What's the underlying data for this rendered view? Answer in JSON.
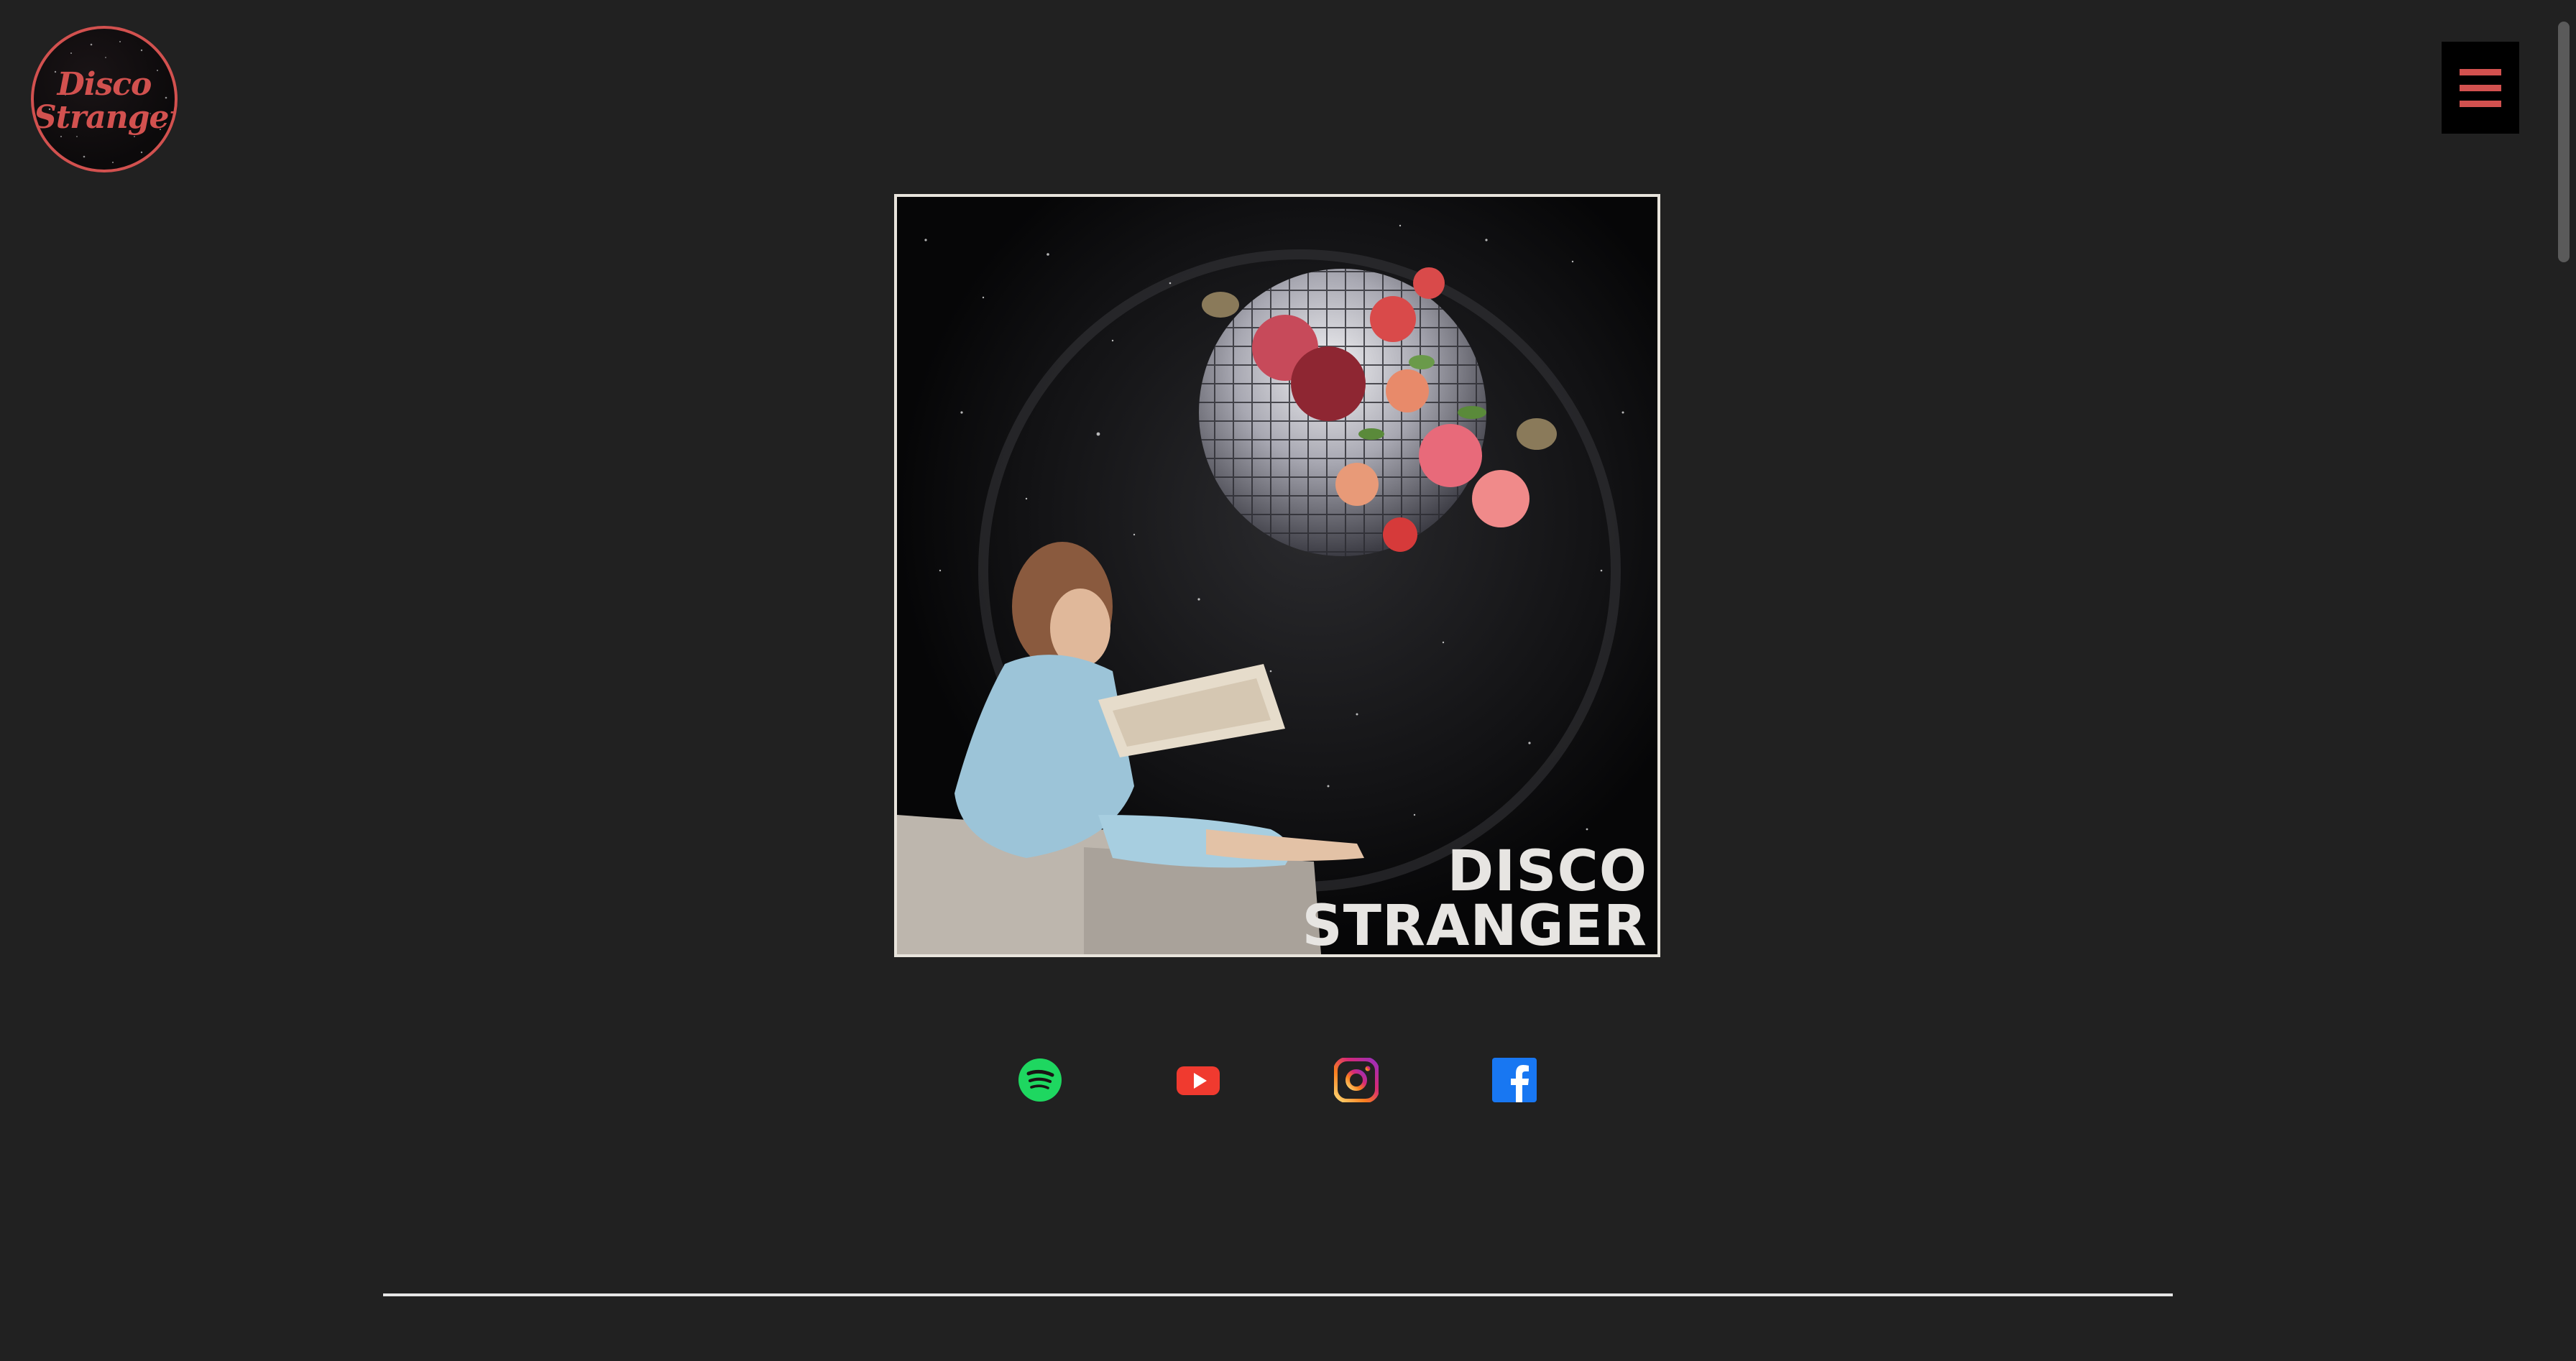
{
  "header": {
    "logo": {
      "line1": "Disco",
      "line2": "Stranger",
      "icon": "disco-stranger-logo"
    },
    "menu_button": {
      "icon": "hamburger-menu-icon",
      "color": "#d2514f"
    }
  },
  "album": {
    "title_line1": "DISCO",
    "title_line2": "STRANGER",
    "image": "album-cover-art"
  },
  "social_links": [
    {
      "name": "spotify",
      "icon": "spotify-icon",
      "color": "#1ed760"
    },
    {
      "name": "youtube",
      "icon": "youtube-icon",
      "color": "#f03a2f"
    },
    {
      "name": "instagram",
      "icon": "instagram-icon",
      "color": "#e1306c"
    },
    {
      "name": "facebook",
      "icon": "facebook-icon",
      "color": "#1877f2"
    }
  ],
  "colors": {
    "background": "#212121",
    "accent": "#d2514f",
    "divider": "#e6e6e6"
  }
}
